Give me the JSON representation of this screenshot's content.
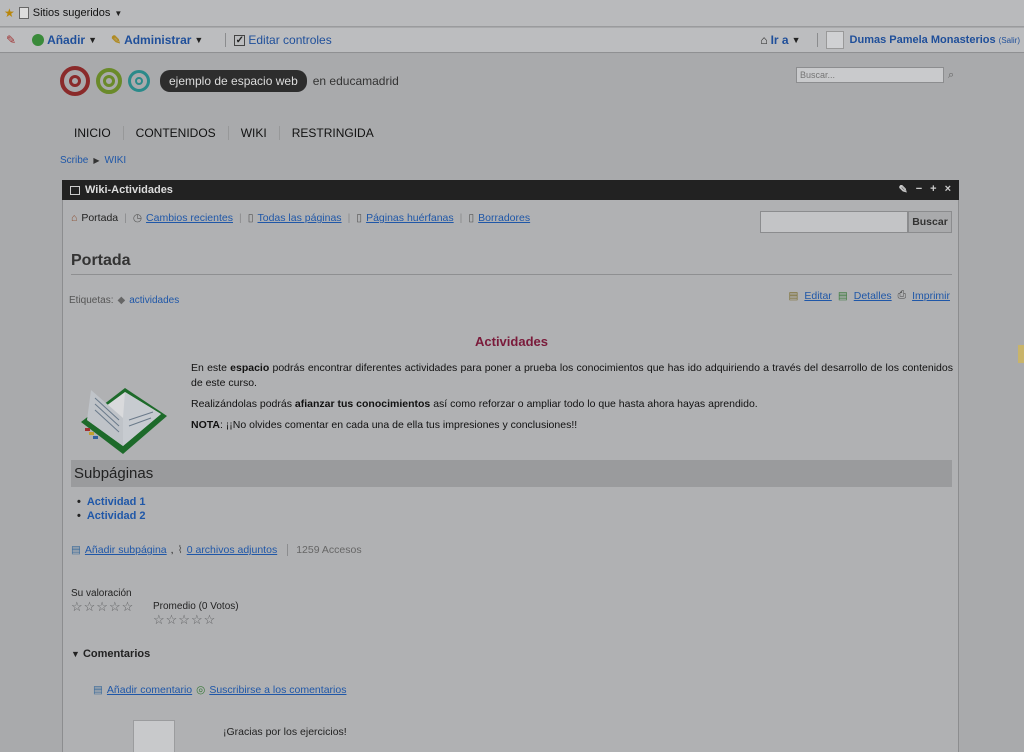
{
  "browser": {
    "bookmark": "Sitios sugeridos"
  },
  "toolbar": {
    "add": "Añadir",
    "admin": "Administrar",
    "edit": "Editar controles",
    "goto": "Ir a",
    "user": "Dumas Pamela Monasterios",
    "logout": "(Salir)"
  },
  "site": {
    "pill": "ejemplo de espacio web",
    "suffix": "en educamadrid",
    "search_placeholder": "Buscar..."
  },
  "nav": [
    "INICIO",
    "CONTENIDOS",
    "WIKI",
    "RESTRINGIDA"
  ],
  "breadcrumb": {
    "root": "Scribe",
    "current": "WIKI"
  },
  "portlet": {
    "title": "Wiki-Actividades",
    "controls": [
      "✎",
      "−",
      "+",
      "×"
    ]
  },
  "wiki": {
    "tabs": {
      "front": "Portada",
      "recent": "Cambios recientes",
      "all": "Todas las páginas",
      "orphan": "Páginas huérfanas",
      "drafts": "Borradores"
    },
    "search_button": "Buscar",
    "page_title": "Portada",
    "tags_label": "Etiquetas:",
    "tag": "actividades",
    "actions": {
      "edit": "Editar",
      "details": "Detalles",
      "print": "Imprimir"
    },
    "heading": "Actividades",
    "p1_a": "En este ",
    "p1_b": "espacio",
    "p1_c": " podrás encontrar diferentes actividades para poner a prueba los conocimientos que has ido adquiriendo a través del desarrollo de los contenidos de este curso.",
    "p2_a": "Realizándolas podrás ",
    "p2_b": "afianzar tus conocimientos",
    "p2_c": " así como reforzar o ampliar todo lo que hasta ahora hayas aprendido.",
    "p3_a": "NOTA",
    "p3_b": ": ¡¡No olvides comentar en cada una de ella tus impresiones y conclusiones!!",
    "subpages_title": "Subpáginas",
    "subpages": [
      "Actividad 1",
      "Actividad 2"
    ],
    "add_subpage": "Añadir subpágina",
    "attachments": "0 archivos adjuntos",
    "views": "1259 Accesos",
    "rating_label": "Su valoración",
    "average": "Promedio (0 Votos)",
    "stars": "☆☆☆☆☆",
    "comments_title": "Comentarios",
    "add_comment": "Añadir comentario",
    "subscribe": "Suscribirse a los comentarios",
    "comment_text": "¡Gracias por los ejercicios!"
  }
}
